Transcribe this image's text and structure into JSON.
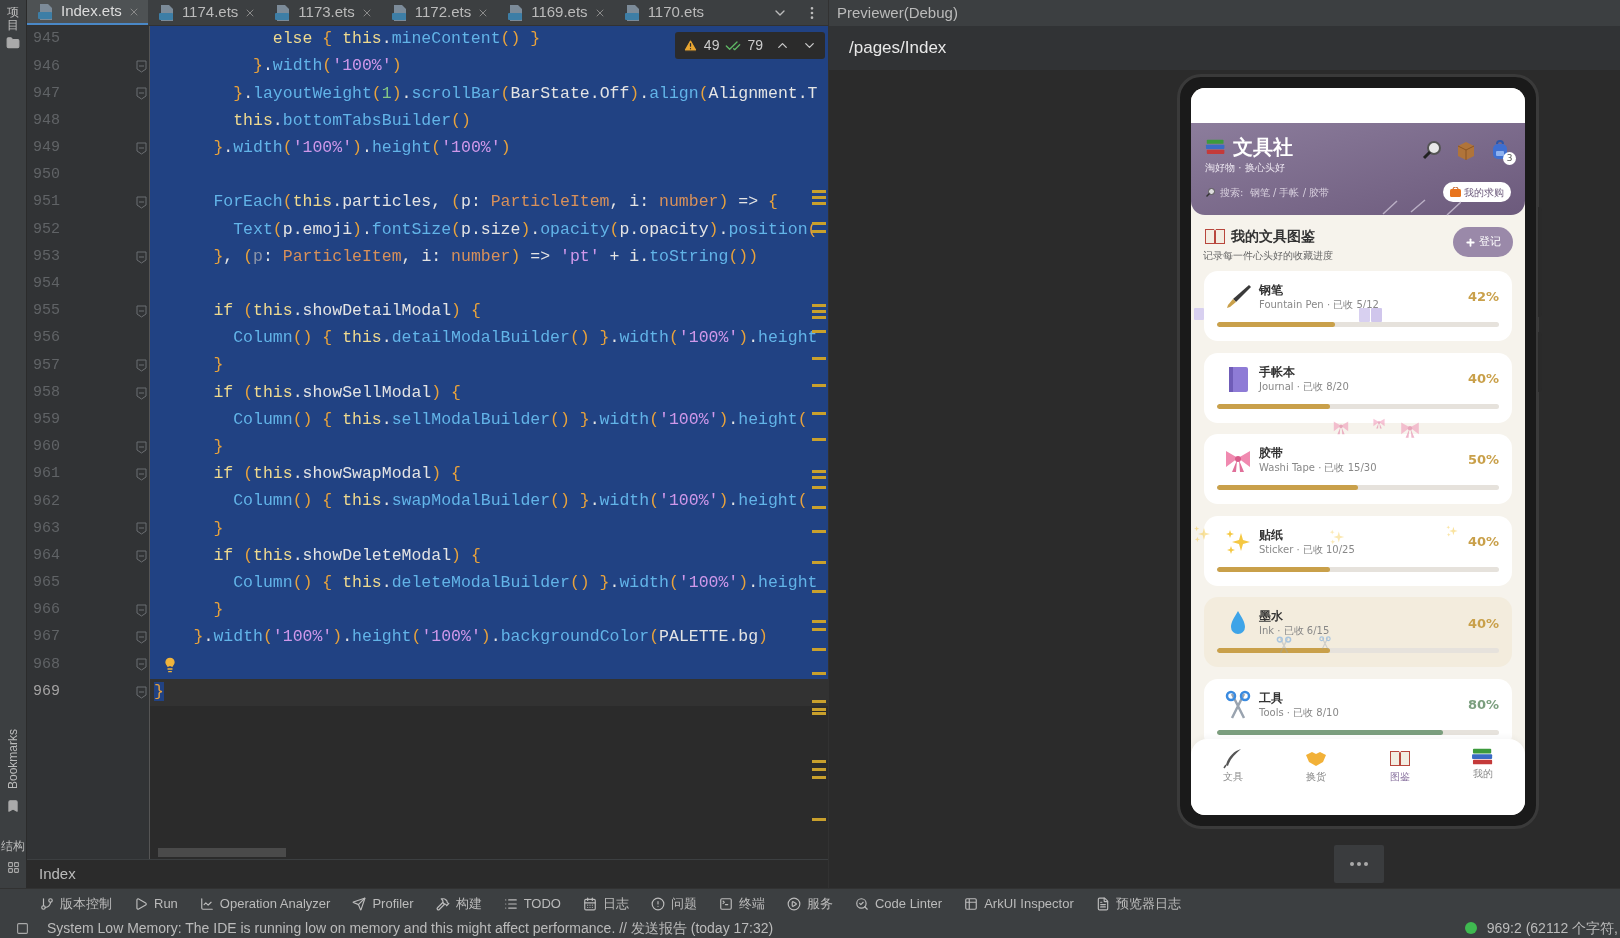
{
  "left_strip": {
    "project_label": "项目",
    "bookmarks_label": "Bookmarks",
    "structure_label": "结构"
  },
  "editor": {
    "tabs": [
      {
        "label": "Index.ets",
        "selected": true,
        "closable": true
      },
      {
        "label": "1174.ets",
        "selected": false,
        "closable": true
      },
      {
        "label": "1173.ets",
        "selected": false,
        "closable": true
      },
      {
        "label": "1172.ets",
        "selected": false,
        "closable": true
      },
      {
        "label": "1169.ets",
        "selected": false,
        "closable": true
      },
      {
        "label": "1170.ets",
        "selected": false,
        "closable": false
      }
    ],
    "inspection": {
      "warnings": "49",
      "weak_warnings": "79"
    },
    "lines": [
      {
        "number": "945",
        "selected": true,
        "fold": false,
        "tokens": [
          {
            "kind": "kw",
            "text": "            else "
          },
          {
            "kind": "pu",
            "text": "{ "
          },
          {
            "kind": "kw",
            "text": "this"
          },
          {
            "kind": "p",
            "text": "."
          },
          {
            "kind": "fn",
            "text": "mineContent"
          },
          {
            "kind": "pu",
            "text": "() }"
          }
        ]
      },
      {
        "number": "946",
        "selected": true,
        "fold": true,
        "tokens": [
          {
            "kind": "pu",
            "text": "          }"
          },
          {
            "kind": "p",
            "text": "."
          },
          {
            "kind": "fn",
            "text": "width"
          },
          {
            "kind": "pu",
            "text": "("
          },
          {
            "kind": "st",
            "text": "'100%'"
          },
          {
            "kind": "pu",
            "text": ")"
          }
        ]
      },
      {
        "number": "947",
        "selected": true,
        "fold": true,
        "tokens": [
          {
            "kind": "pu",
            "text": "        }"
          },
          {
            "kind": "p",
            "text": "."
          },
          {
            "kind": "fn",
            "text": "layoutWeight"
          },
          {
            "kind": "pu",
            "text": "("
          },
          {
            "kind": "nu",
            "text": "1"
          },
          {
            "kind": "pu",
            "text": ")"
          },
          {
            "kind": "p",
            "text": "."
          },
          {
            "kind": "fn",
            "text": "scrollBar"
          },
          {
            "kind": "pu",
            "text": "("
          },
          {
            "kind": "p",
            "text": "BarState.Off"
          },
          {
            "kind": "pu",
            "text": ")"
          },
          {
            "kind": "p",
            "text": "."
          },
          {
            "kind": "fn",
            "text": "align"
          },
          {
            "kind": "pu",
            "text": "("
          },
          {
            "kind": "p",
            "text": "Alignment.T"
          }
        ]
      },
      {
        "number": "948",
        "selected": true,
        "fold": false,
        "tokens": [
          {
            "kind": "kw",
            "text": "        this"
          },
          {
            "kind": "p",
            "text": "."
          },
          {
            "kind": "fn",
            "text": "bottomTabsBuilder"
          },
          {
            "kind": "pu",
            "text": "()"
          }
        ]
      },
      {
        "number": "949",
        "selected": true,
        "fold": true,
        "tokens": [
          {
            "kind": "pu",
            "text": "      }"
          },
          {
            "kind": "p",
            "text": "."
          },
          {
            "kind": "fn",
            "text": "width"
          },
          {
            "kind": "pu",
            "text": "("
          },
          {
            "kind": "st",
            "text": "'100%'"
          },
          {
            "kind": "pu",
            "text": ")"
          },
          {
            "kind": "p",
            "text": "."
          },
          {
            "kind": "fn",
            "text": "height"
          },
          {
            "kind": "pu",
            "text": "("
          },
          {
            "kind": "st",
            "text": "'100%'"
          },
          {
            "kind": "pu",
            "text": ")"
          }
        ]
      },
      {
        "number": "950",
        "selected": true,
        "fold": false
      },
      {
        "number": "951",
        "selected": true,
        "fold": true,
        "tokens": [
          {
            "kind": "fn",
            "text": "      ForEach"
          },
          {
            "kind": "pu",
            "text": "("
          },
          {
            "kind": "kw",
            "text": "this"
          },
          {
            "kind": "p",
            "text": ".particles, "
          },
          {
            "kind": "pu",
            "text": "("
          },
          {
            "kind": "p",
            "text": "p: "
          },
          {
            "kind": "ty",
            "text": "ParticleItem"
          },
          {
            "kind": "p",
            "text": ", i: "
          },
          {
            "kind": "ty",
            "text": "number"
          },
          {
            "kind": "pu",
            "text": ")"
          },
          {
            "kind": "p",
            "text": " => "
          },
          {
            "kind": "pu",
            "text": "{"
          }
        ]
      },
      {
        "number": "952",
        "selected": true,
        "fold": false,
        "tokens": [
          {
            "kind": "fn",
            "text": "        Text"
          },
          {
            "kind": "pu",
            "text": "("
          },
          {
            "kind": "p",
            "text": "p.emoji"
          },
          {
            "kind": "pu",
            "text": ")"
          },
          {
            "kind": "p",
            "text": "."
          },
          {
            "kind": "fn",
            "text": "fontSize"
          },
          {
            "kind": "pu",
            "text": "("
          },
          {
            "kind": "p",
            "text": "p.size"
          },
          {
            "kind": "pu",
            "text": ")"
          },
          {
            "kind": "p",
            "text": "."
          },
          {
            "kind": "fn",
            "text": "opacity"
          },
          {
            "kind": "pu",
            "text": "("
          },
          {
            "kind": "p",
            "text": "p.opacity"
          },
          {
            "kind": "pu",
            "text": ")"
          },
          {
            "kind": "p",
            "text": "."
          },
          {
            "kind": "fn",
            "text": "position"
          },
          {
            "kind": "pu",
            "text": "("
          }
        ]
      },
      {
        "number": "953",
        "selected": true,
        "fold": true,
        "tokens": [
          {
            "kind": "pu",
            "text": "      }"
          },
          {
            "kind": "p",
            "text": ", "
          },
          {
            "kind": "pu",
            "text": "("
          },
          {
            "kind": "dim",
            "text": "p"
          },
          {
            "kind": "p",
            "text": ": "
          },
          {
            "kind": "ty",
            "text": "ParticleItem"
          },
          {
            "kind": "p",
            "text": ", i: "
          },
          {
            "kind": "ty",
            "text": "number"
          },
          {
            "kind": "pu",
            "text": ")"
          },
          {
            "kind": "p",
            "text": " => "
          },
          {
            "kind": "st",
            "text": "'pt'"
          },
          {
            "kind": "p",
            "text": " + i."
          },
          {
            "kind": "fn",
            "text": "toString"
          },
          {
            "kind": "pu",
            "text": "())"
          }
        ]
      },
      {
        "number": "954",
        "selected": true,
        "fold": false
      },
      {
        "number": "955",
        "selected": true,
        "fold": true,
        "tokens": [
          {
            "kind": "kw",
            "text": "      if "
          },
          {
            "kind": "pu",
            "text": "("
          },
          {
            "kind": "kw",
            "text": "this"
          },
          {
            "kind": "p",
            "text": ".showDetailModal"
          },
          {
            "kind": "pu",
            "text": ") {"
          }
        ]
      },
      {
        "number": "956",
        "selected": true,
        "fold": false,
        "tokens": [
          {
            "kind": "fn",
            "text": "        Column"
          },
          {
            "kind": "pu",
            "text": "() { "
          },
          {
            "kind": "kw",
            "text": "this"
          },
          {
            "kind": "p",
            "text": "."
          },
          {
            "kind": "fn",
            "text": "detailModalBuilder"
          },
          {
            "kind": "pu",
            "text": "() }"
          },
          {
            "kind": "p",
            "text": "."
          },
          {
            "kind": "fn",
            "text": "width"
          },
          {
            "kind": "pu",
            "text": "("
          },
          {
            "kind": "st",
            "text": "'100%'"
          },
          {
            "kind": "pu",
            "text": ")"
          },
          {
            "kind": "p",
            "text": "."
          },
          {
            "kind": "fn",
            "text": "height"
          }
        ]
      },
      {
        "number": "957",
        "selected": true,
        "fold": true,
        "tokens": [
          {
            "kind": "pu",
            "text": "      }"
          }
        ]
      },
      {
        "number": "958",
        "selected": true,
        "fold": true,
        "tokens": [
          {
            "kind": "kw",
            "text": "      if "
          },
          {
            "kind": "pu",
            "text": "("
          },
          {
            "kind": "kw",
            "text": "this"
          },
          {
            "kind": "p",
            "text": ".showSellModal"
          },
          {
            "kind": "pu",
            "text": ") {"
          }
        ]
      },
      {
        "number": "959",
        "selected": true,
        "fold": false,
        "tokens": [
          {
            "kind": "fn",
            "text": "        Column"
          },
          {
            "kind": "pu",
            "text": "() { "
          },
          {
            "kind": "kw",
            "text": "this"
          },
          {
            "kind": "p",
            "text": "."
          },
          {
            "kind": "fn",
            "text": "sellModalBuilder"
          },
          {
            "kind": "pu",
            "text": "() }"
          },
          {
            "kind": "p",
            "text": "."
          },
          {
            "kind": "fn",
            "text": "width"
          },
          {
            "kind": "pu",
            "text": "("
          },
          {
            "kind": "st",
            "text": "'100%'"
          },
          {
            "kind": "pu",
            "text": ")"
          },
          {
            "kind": "p",
            "text": "."
          },
          {
            "kind": "fn",
            "text": "height"
          },
          {
            "kind": "pu",
            "text": "("
          }
        ]
      },
      {
        "number": "960",
        "selected": true,
        "fold": true,
        "tokens": [
          {
            "kind": "pu",
            "text": "      }"
          }
        ]
      },
      {
        "number": "961",
        "selected": true,
        "fold": true,
        "tokens": [
          {
            "kind": "kw",
            "text": "      if "
          },
          {
            "kind": "pu",
            "text": "("
          },
          {
            "kind": "kw",
            "text": "this"
          },
          {
            "kind": "p",
            "text": ".showSwapModal"
          },
          {
            "kind": "pu",
            "text": ") {"
          }
        ]
      },
      {
        "number": "962",
        "selected": true,
        "fold": false,
        "tokens": [
          {
            "kind": "fn",
            "text": "        Column"
          },
          {
            "kind": "pu",
            "text": "() { "
          },
          {
            "kind": "kw",
            "text": "this"
          },
          {
            "kind": "p",
            "text": "."
          },
          {
            "kind": "fn",
            "text": "swapModalBuilder"
          },
          {
            "kind": "pu",
            "text": "() }"
          },
          {
            "kind": "p",
            "text": "."
          },
          {
            "kind": "fn",
            "text": "width"
          },
          {
            "kind": "pu",
            "text": "("
          },
          {
            "kind": "st",
            "text": "'100%'"
          },
          {
            "kind": "pu",
            "text": ")"
          },
          {
            "kind": "p",
            "text": "."
          },
          {
            "kind": "fn",
            "text": "height"
          },
          {
            "kind": "pu",
            "text": "("
          }
        ]
      },
      {
        "number": "963",
        "selected": true,
        "fold": true,
        "tokens": [
          {
            "kind": "pu",
            "text": "      }"
          }
        ]
      },
      {
        "number": "964",
        "selected": true,
        "fold": true,
        "tokens": [
          {
            "kind": "kw",
            "text": "      if "
          },
          {
            "kind": "pu",
            "text": "("
          },
          {
            "kind": "kw",
            "text": "this"
          },
          {
            "kind": "p",
            "text": ".showDeleteModal"
          },
          {
            "kind": "pu",
            "text": ") {"
          }
        ]
      },
      {
        "number": "965",
        "selected": true,
        "fold": false,
        "tokens": [
          {
            "kind": "fn",
            "text": "        Column"
          },
          {
            "kind": "pu",
            "text": "() { "
          },
          {
            "kind": "kw",
            "text": "this"
          },
          {
            "kind": "p",
            "text": "."
          },
          {
            "kind": "fn",
            "text": "deleteModalBuilder"
          },
          {
            "kind": "pu",
            "text": "() }"
          },
          {
            "kind": "p",
            "text": "."
          },
          {
            "kind": "fn",
            "text": "width"
          },
          {
            "kind": "pu",
            "text": "("
          },
          {
            "kind": "st",
            "text": "'100%'"
          },
          {
            "kind": "pu",
            "text": ")"
          },
          {
            "kind": "p",
            "text": "."
          },
          {
            "kind": "fn",
            "text": "height"
          }
        ]
      },
      {
        "number": "966",
        "selected": true,
        "fold": true,
        "tokens": [
          {
            "kind": "pu",
            "text": "      }"
          }
        ]
      },
      {
        "number": "967",
        "selected": true,
        "fold": true,
        "tokens": [
          {
            "kind": "pu",
            "text": "    }"
          },
          {
            "kind": "p",
            "text": "."
          },
          {
            "kind": "fn",
            "text": "width"
          },
          {
            "kind": "pu",
            "text": "("
          },
          {
            "kind": "st",
            "text": "'100%'"
          },
          {
            "kind": "pu",
            "text": ")"
          },
          {
            "kind": "p",
            "text": "."
          },
          {
            "kind": "fn",
            "text": "height"
          },
          {
            "kind": "pu",
            "text": "("
          },
          {
            "kind": "st",
            "text": "'100%'"
          },
          {
            "kind": "pu",
            "text": ")"
          },
          {
            "kind": "p",
            "text": "."
          },
          {
            "kind": "fn",
            "text": "backgroundColor"
          },
          {
            "kind": "pu",
            "text": "("
          },
          {
            "kind": "p",
            "text": "PALETTE.bg"
          },
          {
            "kind": "pu",
            "text": ")"
          }
        ]
      },
      {
        "number": "968",
        "selected": true,
        "fold": true,
        "bulb": true
      },
      {
        "number": "969",
        "selected": false,
        "current": true,
        "fold": true,
        "tokens": [
          {
            "kind": "pu",
            "text": "}",
            "selected": true
          }
        ]
      }
    ],
    "breadcrumb": "Index"
  },
  "previewer": {
    "title": "Previewer(Debug)",
    "path": "/pages/Index",
    "app": {
      "header": {
        "title": "文具社",
        "subtitle": "淘好物 · 换心头好",
        "search_placeholder": "搜索:  钢笔 / 手帐 / 胶带",
        "wish_button": "我的求购",
        "badge": "3"
      },
      "section": {
        "title": "我的文具图鉴",
        "subtitle": "记录每一件心头好的收藏进度",
        "add_button": "登记"
      },
      "cards": [
        {
          "name": "钢笔",
          "detail": "Fountain Pen · 已收 5/12",
          "percent": "42%",
          "level": 0.42,
          "color": "#c9a04a",
          "selected": false
        },
        {
          "name": "手帐本",
          "detail": "Journal · 已收 8/20",
          "percent": "40%",
          "level": 0.4,
          "color": "#c9a04a",
          "selected": false
        },
        {
          "name": "胶带",
          "detail": "Washi Tape · 已收 15/30",
          "percent": "50%",
          "level": 0.5,
          "color": "#c9a04a",
          "selected": false
        },
        {
          "name": "贴纸",
          "detail": "Sticker · 已收 10/25",
          "percent": "40%",
          "level": 0.4,
          "color": "#c9a04a",
          "selected": false
        },
        {
          "name": "墨水",
          "detail": "Ink · 已收 6/15",
          "percent": "40%",
          "level": 0.4,
          "color": "#c9a04a",
          "selected": true
        },
        {
          "name": "工具",
          "detail": "Tools · 已收 8/10",
          "percent": "80%",
          "level": 0.8,
          "color": "#7b9e7e",
          "selected": false
        }
      ],
      "tabs": [
        {
          "label": "文具",
          "selected": false
        },
        {
          "label": "换货",
          "selected": false
        },
        {
          "label": "图鉴",
          "selected": true
        },
        {
          "label": "我的",
          "selected": false
        }
      ]
    }
  },
  "toolbar": [
    {
      "label": "版本控制"
    },
    {
      "label": "Run"
    },
    {
      "label": "Operation Analyzer"
    },
    {
      "label": "Profiler"
    },
    {
      "label": "构建"
    },
    {
      "label": "TODO"
    },
    {
      "label": "日志"
    },
    {
      "label": "问题"
    },
    {
      "label": "终端"
    },
    {
      "label": "服务"
    },
    {
      "label": "Code Linter"
    },
    {
      "label": "ArkUI Inspector"
    },
    {
      "label": "预览器日志"
    }
  ],
  "status_bar": {
    "message": "System Low Memory: The IDE is running low on memory and this might affect performance. // 发送报告 (today 17:32)",
    "position": "969:2 (62112 个字符,"
  }
}
